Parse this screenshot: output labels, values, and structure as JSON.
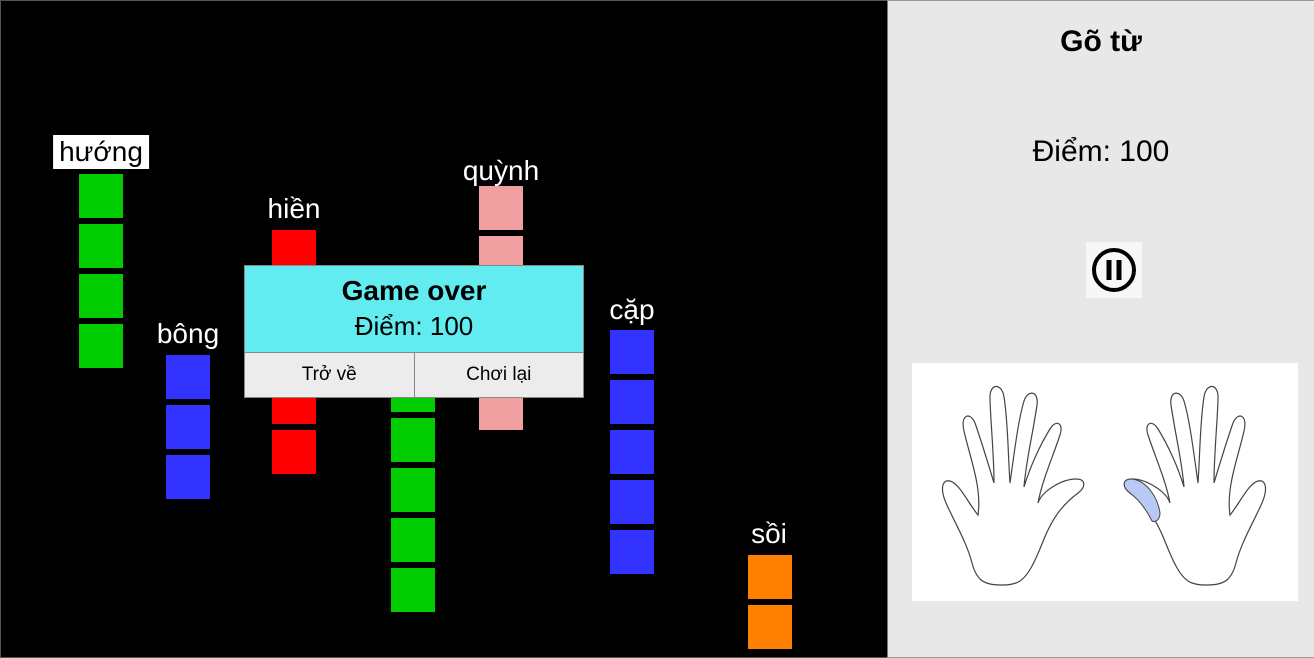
{
  "game": {
    "words": [
      {
        "text": "hướng",
        "color": "#00cc00",
        "blocks": 4,
        "active": true
      },
      {
        "text": "bông",
        "color": "#3333ff",
        "blocks": 3,
        "active": false
      },
      {
        "text": "hiền",
        "color": "#ff0000",
        "blocks": 5,
        "active": false
      },
      {
        "text": "quỳnh",
        "color": "#f0a0a0",
        "blocks": 5,
        "active": false
      },
      {
        "text": "",
        "color": "#00cc00",
        "blocks": 5,
        "active": false
      },
      {
        "text": "cặp",
        "color": "#3333ff",
        "blocks": 5,
        "active": false
      },
      {
        "text": "sồi",
        "color": "#ff8000",
        "blocks": 2,
        "active": false
      }
    ]
  },
  "dialog": {
    "title": "Game over",
    "score_text": "Điểm: 100",
    "back_label": "Trở về",
    "replay_label": "Chơi lại",
    "header_color": "#62ecef"
  },
  "panel": {
    "title": "Gõ từ",
    "score_text": "Điểm: 100",
    "pause_icon": "pause-icon",
    "hands_icon": "hands-keyboard-guide",
    "highlight_finger": "left thumb of right hand",
    "highlight_color": "#b9c8f5"
  }
}
